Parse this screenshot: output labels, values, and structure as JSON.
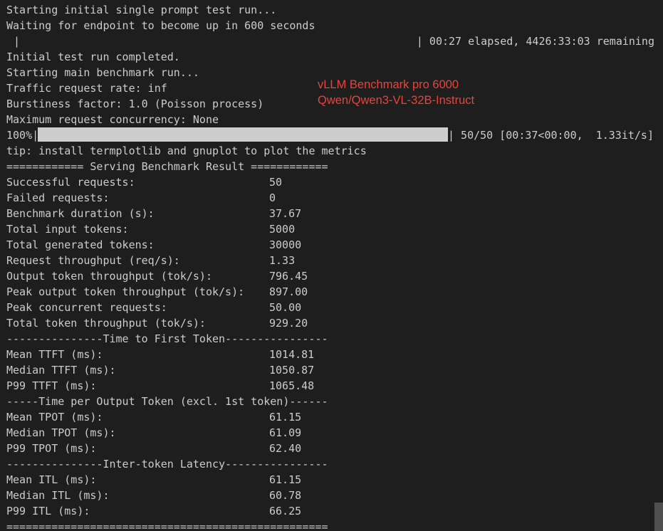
{
  "overlay": {
    "line1": "vLLM Benchmark pro 6000",
    "line2": "Qwen/Qwen3-VL-32B-Instruct"
  },
  "log": {
    "starting_test": "Starting initial single prompt test run...",
    "waiting": "Waiting for endpoint to become up in 600 seconds",
    "wait_bar_left": "|",
    "wait_bar_right": "| 00:27 elapsed, 4426:33:03 remaining",
    "test_completed": "Initial test run completed.",
    "starting_main": "Starting main benchmark run...",
    "traffic_rate": "Traffic request rate: inf",
    "burstiness": "Burstiness factor: 1.0 (Poisson process)",
    "max_concurrency": "Maximum request concurrency: None",
    "progress_percent_label": "100%|",
    "progress_fraction": 1.0,
    "progress_right": "| 50/50 [00:37<00:00,  1.33it/s]",
    "tip": "tip: install termplotlib and gnuplot to plot the metrics"
  },
  "result": {
    "header": "============ Serving Benchmark Result ============",
    "rows": [
      {
        "label": "Successful requests:",
        "value": "50"
      },
      {
        "label": "Failed requests:",
        "value": "0"
      },
      {
        "label": "Benchmark duration (s):",
        "value": "37.67"
      },
      {
        "label": "Total input tokens:",
        "value": "5000"
      },
      {
        "label": "Total generated tokens:",
        "value": "30000"
      },
      {
        "label": "Request throughput (req/s):",
        "value": "1.33"
      },
      {
        "label": "Output token throughput (tok/s):",
        "value": "796.45"
      },
      {
        "label": "Peak output token throughput (tok/s):",
        "value": "897.00"
      },
      {
        "label": "Peak concurrent requests:",
        "value": "50.00"
      },
      {
        "label": "Total token throughput (tok/s):",
        "value": "929.20"
      }
    ],
    "ttft_header": "---------------Time to First Token----------------",
    "ttft_rows": [
      {
        "label": "Mean TTFT (ms):",
        "value": "1014.81"
      },
      {
        "label": "Median TTFT (ms):",
        "value": "1050.87"
      },
      {
        "label": "P99 TTFT (ms):",
        "value": "1065.48"
      }
    ],
    "tpot_header": "-----Time per Output Token (excl. 1st token)------",
    "tpot_rows": [
      {
        "label": "Mean TPOT (ms):",
        "value": "61.15"
      },
      {
        "label": "Median TPOT (ms):",
        "value": "61.09"
      },
      {
        "label": "P99 TPOT (ms):",
        "value": "62.40"
      }
    ],
    "itl_header": "---------------Inter-token Latency----------------",
    "itl_rows": [
      {
        "label": "Mean ITL (ms):",
        "value": "61.15"
      },
      {
        "label": "Median ITL (ms):",
        "value": "60.78"
      },
      {
        "label": "P99 ITL (ms):",
        "value": "66.25"
      }
    ],
    "footer": "=================================================="
  }
}
